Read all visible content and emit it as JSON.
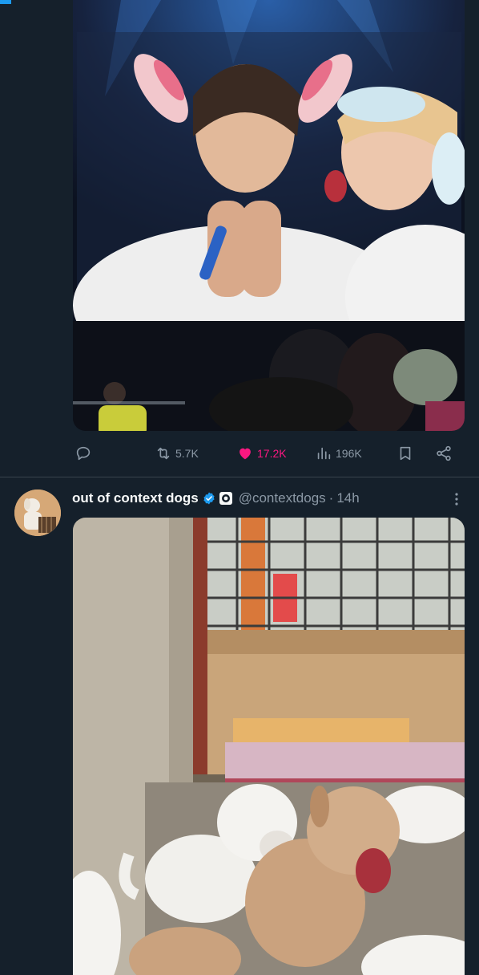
{
  "tweet_top": {
    "stats": {
      "retweets": "5.7K",
      "likes": "17.2K",
      "views": "196K"
    }
  },
  "tweet_bottom": {
    "author": {
      "display_name": "out of context dogs",
      "handle": "@contextdogs",
      "separator": "·",
      "time": "14h"
    }
  },
  "colors": {
    "background": "#15202b",
    "accent": "#1d9bf0",
    "like": "#f91880",
    "muted": "#8b98a5"
  },
  "icons": {
    "reply": "reply-icon",
    "retweet": "retweet-icon",
    "like": "heart-icon",
    "views": "views-icon",
    "bookmark": "bookmark-icon",
    "share": "share-icon",
    "verified": "verified-badge-icon",
    "more": "more-icon"
  }
}
